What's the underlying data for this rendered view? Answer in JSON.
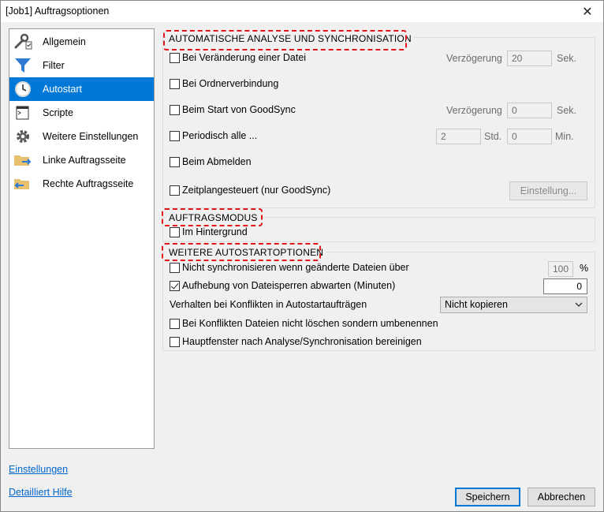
{
  "window": {
    "title": "[Job1] Auftragsoptionen",
    "close_glyph": "✕"
  },
  "sidebar": {
    "items": [
      {
        "label": "Allgemein",
        "icon": "wrench-icon"
      },
      {
        "label": "Filter",
        "icon": "funnel-icon"
      },
      {
        "label": "Autostart",
        "icon": "clock-icon"
      },
      {
        "label": "Scripte",
        "icon": "terminal-icon"
      },
      {
        "label": "Weitere Einstellungen",
        "icon": "gear-icon"
      },
      {
        "label": "Linke Auftragsseite",
        "icon": "folder-right-arrow-icon"
      },
      {
        "label": "Rechte Auftragsseite",
        "icon": "folder-left-arrow-icon"
      }
    ],
    "active": "Autostart"
  },
  "links": {
    "settings": "Einstellungen",
    "help": "Detailliert Hilfe"
  },
  "analysis": {
    "title": "AUTOMATISCHE ANALYSE UND SYNCHRONISATION",
    "on_file_change": "Bei Veränderung einer Datei",
    "delay_label_1": "Verzögerung",
    "delay_value_1": "20",
    "delay_unit_1": "Sek.",
    "on_folder_connect": "Bei Ordnerverbindung",
    "on_goodsync_start": "Beim Start von GoodSync",
    "delay_label_2": "Verzögerung",
    "delay_value_2": "0",
    "delay_unit_2": "Sek.",
    "periodic": "Periodisch alle ...",
    "periodic_hours": "2",
    "hours_unit": "Std.",
    "periodic_minutes": "0",
    "minutes_unit": "Min.",
    "on_logoff": "Beim Abmelden",
    "scheduled": "Zeitplangesteuert (nur GoodSync)",
    "schedule_button": "Einstellung..."
  },
  "job_mode": {
    "title": "AUFTRAGSMODUS",
    "background": "Im Hintergrund"
  },
  "more": {
    "title": "WEITERE AUTOSTARTOPTIONEN",
    "no_sync_changed": "Nicht synchronisieren wenn geänderte Dateien über",
    "percent_value": "100",
    "percent_unit": "%",
    "wait_locks": "Aufhebung von Dateisperren abwarten (Minuten)",
    "wait_locks_value": "0",
    "wait_locks_checked": true,
    "conflict_behavior": "Verhalten bei Konflikten in Autostartaufträgen",
    "conflict_option": "Nicht kopieren",
    "rename_conflicts": "Bei Konflikten Dateien nicht löschen sondern umbenennen",
    "clean_main_window": "Hauptfenster nach Analyse/Synchronisation bereinigen"
  },
  "footer": {
    "save": "Speichern",
    "cancel": "Abbrechen"
  },
  "colors": {
    "accent": "#0078d7",
    "highlight": "#e0161b",
    "link": "#0066cc"
  }
}
